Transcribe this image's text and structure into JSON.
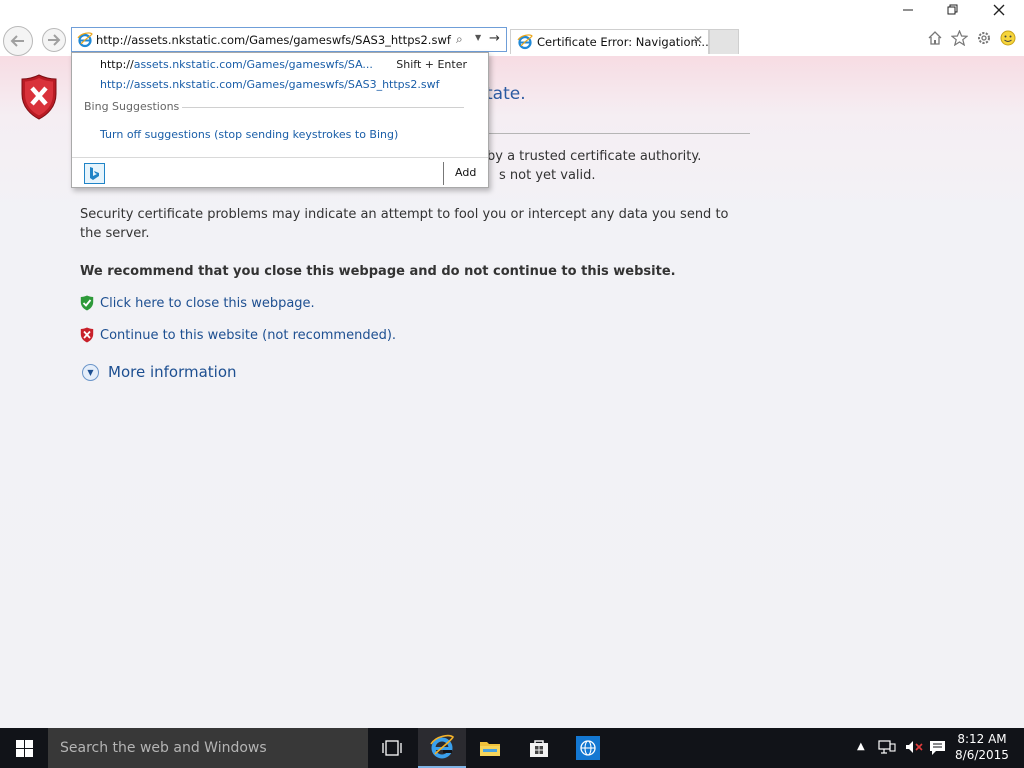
{
  "window": {
    "minimize_icon": "minimize-icon",
    "restore_icon": "restore-icon",
    "close_icon": "close-icon"
  },
  "address_bar": {
    "url": "http://assets.nkstatic.com/Games/gameswfs/SAS3_https2.swf"
  },
  "tab": {
    "title": "Certificate Error: Navigation...",
    "close_glyph": "✕"
  },
  "autocomplete": {
    "suggestion_prefix": "http://",
    "suggestion_rest": "assets.nkstatic.com/Games/gameswfs/SA...",
    "shortcut": "Shift + Enter",
    "history_url": "http://assets.nkstatic.com/Games/gameswfs/SAS3_https2.swf",
    "section_label": "Bing Suggestions",
    "turn_off_link": "Turn off suggestions (stop sending keystrokes to Bing)",
    "add_label": "Add"
  },
  "page": {
    "heading_visible": "tate.",
    "problem_line1": "by a trusted certificate authority.",
    "problem_line2": "s not yet valid.",
    "warning": "Security certificate problems may indicate an attempt to fool you or intercept any data you send to the server.",
    "recommendation": "We recommend that you close this webpage and do not continue to this website.",
    "close_link": "Click here to close this webpage.",
    "continue_link": "Continue to this website (not recommended).",
    "more_info": "More information"
  },
  "taskbar": {
    "search_placeholder": "Search the web and Windows",
    "time": "8:12 AM",
    "date": "8/6/2015"
  },
  "colors": {
    "link": "#1d4f91",
    "heading": "#2b5aa1",
    "taskbar": "#111318",
    "shield_red": "#c8202a",
    "shield_green": "#2e9a3a"
  }
}
